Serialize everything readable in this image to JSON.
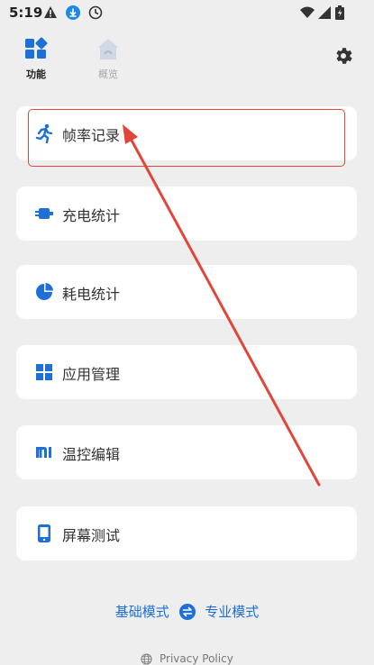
{
  "status_bar": {
    "time": "5:19",
    "icons": [
      "warning-icon",
      "download-icon",
      "clock-icon",
      "wifi-icon",
      "signal-icon",
      "battery-icon"
    ]
  },
  "nav": {
    "tabs": [
      {
        "label": "功能",
        "icon": "features-icon",
        "active": true
      },
      {
        "label": "概览",
        "icon": "overview-icon",
        "active": false
      }
    ],
    "settings_icon": "gear-icon"
  },
  "cards": [
    {
      "label": "帧率记录",
      "icon": "running-icon"
    },
    {
      "label": "充电统计",
      "icon": "charger-icon"
    },
    {
      "label": "耗电统计",
      "icon": "pie-icon"
    },
    {
      "label": "应用管理",
      "icon": "grid-icon"
    },
    {
      "label": "温控编辑",
      "icon": "mi-icon"
    },
    {
      "label": "屏幕测试",
      "icon": "phone-icon"
    }
  ],
  "mode_switch": {
    "basic": "基础模式",
    "pro": "专业模式"
  },
  "privacy": "Privacy Policy",
  "colors": {
    "accent": "#1e6fd6",
    "annotation": "#e0463a",
    "background": "#eeeeee"
  }
}
